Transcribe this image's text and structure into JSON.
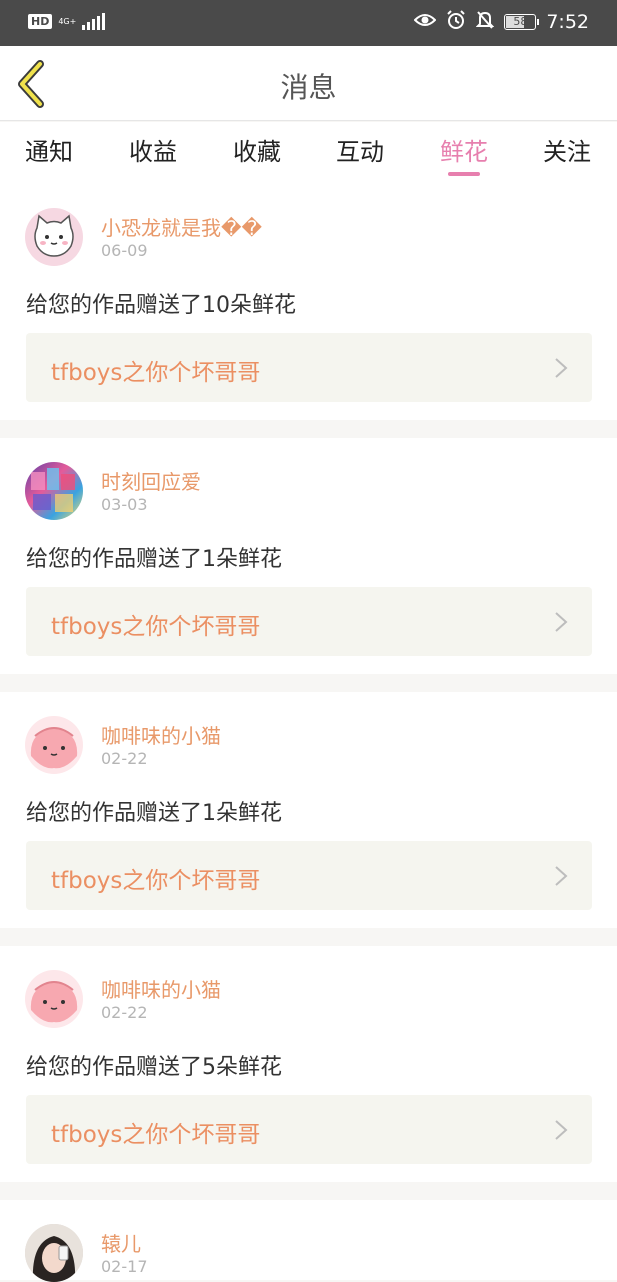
{
  "status_bar": {
    "hd": "HD",
    "network": "4G+",
    "battery": "58",
    "time": "7:52"
  },
  "header": {
    "title": "消息"
  },
  "tabs": [
    {
      "label": "通知"
    },
    {
      "label": "收益"
    },
    {
      "label": "收藏"
    },
    {
      "label": "互动"
    },
    {
      "label": "鲜花",
      "active": true
    },
    {
      "label": "关注"
    }
  ],
  "messages": [
    {
      "user": "小恐龙就是我��",
      "date": "06-09",
      "text": "给您的作品赠送了10朵鲜花",
      "work": "tfboys之你个坏哥哥",
      "avatar": "cat-avatar"
    },
    {
      "user": "时刻回应爱",
      "date": "03-03",
      "text": "给您的作品赠送了1朵鲜花",
      "work": "tfboys之你个坏哥哥",
      "avatar": "collage-avatar"
    },
    {
      "user": "咖啡味的小猫",
      "date": "02-22",
      "text": "给您的作品赠送了1朵鲜花",
      "work": "tfboys之你个坏哥哥",
      "avatar": "peach-avatar"
    },
    {
      "user": "咖啡味的小猫",
      "date": "02-22",
      "text": "给您的作品赠送了5朵鲜花",
      "work": "tfboys之你个坏哥哥",
      "avatar": "peach-avatar"
    },
    {
      "user": "辕儿",
      "date": "02-17",
      "avatar": "girl-avatar"
    }
  ],
  "colors": {
    "accent": "#e77fae",
    "name": "#e8996a",
    "work_link": "#eb8f62"
  },
  "icons": [
    "back-icon",
    "eye-icon",
    "alarm-icon",
    "bell-off-icon",
    "chevron-right-icon"
  ]
}
